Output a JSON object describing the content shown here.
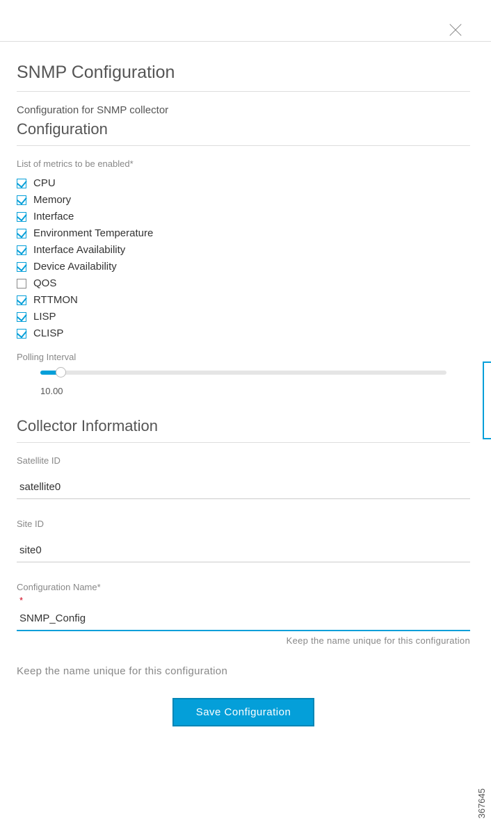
{
  "header": {
    "title": "SNMP Configuration",
    "subtitle": "Configuration for SNMP collector"
  },
  "config_section": {
    "heading": "Configuration",
    "metrics_label": "List of metrics to be enabled*",
    "metrics": [
      {
        "label": "CPU",
        "checked": true
      },
      {
        "label": "Memory",
        "checked": true
      },
      {
        "label": "Interface",
        "checked": true
      },
      {
        "label": "Environment Temperature",
        "checked": true
      },
      {
        "label": "Interface Availability",
        "checked": true
      },
      {
        "label": "Device Availability",
        "checked": true
      },
      {
        "label": "QOS",
        "checked": false
      },
      {
        "label": "RTTMON",
        "checked": true
      },
      {
        "label": "LISP",
        "checked": true
      },
      {
        "label": "CLISP",
        "checked": true
      }
    ],
    "polling_label": "Polling Interval",
    "polling_value": "10.00"
  },
  "collector_section": {
    "heading": "Collector Information",
    "satellite_label": "Satellite ID",
    "satellite_value": "satellite0",
    "site_label": "Site ID",
    "site_value": "site0",
    "config_name_label": "Configuration Name*",
    "config_name_value": "SNMP_Config",
    "required_mark": "*",
    "helper_text": "Keep the name unique for this configuration"
  },
  "footer": {
    "save_label": "Save Configuration"
  },
  "image_id": "367645",
  "colors": {
    "accent": "#049fd9",
    "text": "#555",
    "muted": "#888",
    "error": "#d0021b"
  }
}
